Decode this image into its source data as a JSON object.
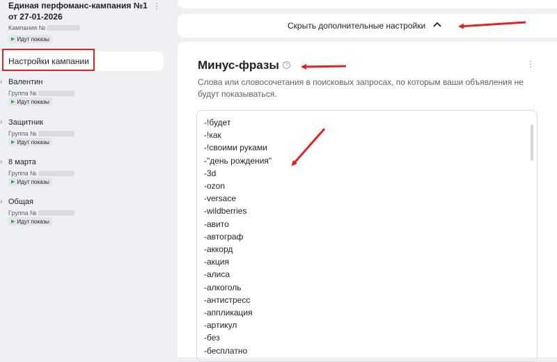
{
  "sidebar": {
    "campaign": {
      "title": "Единая перфоманс-кампания №1 от 27-01-2026",
      "id_label": "Кампания №",
      "status": "Идут показы"
    },
    "settings_label": "Настройки кампании",
    "groups": [
      {
        "name": "Валентин",
        "id_label": "Группа №",
        "status": "Идут показы"
      },
      {
        "name": "Защитник",
        "id_label": "Группа №",
        "status": "Идут показы"
      },
      {
        "name": "8 марта",
        "id_label": "Группа №",
        "status": "Идут показы"
      },
      {
        "name": "Общая",
        "id_label": "Группа №",
        "status": "Идут показы"
      }
    ]
  },
  "toggle": {
    "label": "Скрыть дополнительные настройки"
  },
  "section": {
    "title": "Минус-фразы",
    "help_icon": "question-icon",
    "description": "Слова или словосочетания в поисковых запросах, по которым ваши объявления не будут показываться."
  },
  "phrases": [
    "-!будет",
    "-!как",
    "-!своими руками",
    "-\"день рождения\"",
    "-3d",
    "-ozon",
    "-versace",
    "-wildberries",
    "-авито",
    "-автограф",
    "-аккорд",
    "-акция",
    "-алиса",
    "-алкоголь",
    "-антистресс",
    "-аппликация",
    "-артикул",
    "-без",
    "-бесплатно"
  ],
  "colors": {
    "accent_red": "#e52222",
    "status_green": "#2fa84f",
    "page_bg": "#eef0f3"
  }
}
